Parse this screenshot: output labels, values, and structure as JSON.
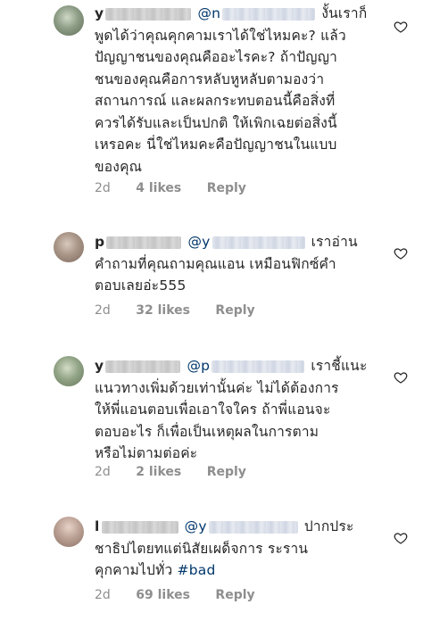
{
  "comments": [
    {
      "username": "y",
      "mention": "@n",
      "lines": [
        "งั้นเราก็",
        "พูดได้ว่าคุณคุกคามเราได้ใช่ไหมคะ? แล้ว",
        "ปัญญาชนของคุณคืออะไรคะ? ถ้าปัญญา",
        "ชนของคุณคือการหลับหูหลับตามองว่า",
        "สถานการณ์ และผลกระทบตอนนี้คือสิ่งที่",
        "ควรได้รับและเป็นปกติ ให้เพิกเฉยต่อสิ่งนี้",
        "เหรอคะ นี่ใช่ไหมคะคือปัญญาชนในแบบ",
        "ของคุณ"
      ],
      "time": "2d",
      "likes": "4 likes",
      "reply": "Reply"
    },
    {
      "username": "p",
      "mention": "@y",
      "lines": [
        "เราอ่าน",
        "คำถามที่คุณถามคุณแอน เหมือนฟิกซ์คำ",
        "ตอบเลยอ่ะ555"
      ],
      "time": "2d",
      "likes": "32 likes",
      "reply": "Reply"
    },
    {
      "username": "y",
      "mention": "@p",
      "lines": [
        "เราชี้แนะ",
        "แนวทางเพิ่มด้วยเท่านั้นค่ะ ไม่ได้ต้องการ",
        "ให้พี่แอนตอบเพื่อเอาใจใคร ถ้าพี่แอนจะ",
        "ตอบอะไร ก็เพื่อเป็นเหตุผลในการตาม",
        "หรือไม่ตามต่อค่ะ"
      ],
      "time": "2d",
      "likes": "2 likes",
      "reply": "Reply"
    },
    {
      "username": "l",
      "mention": "@y",
      "lines": [
        "ปากประ",
        "ชาธิปไตยทแต่นิสัยเผด็จการ ระราน",
        "คุกคามไปทั่ว"
      ],
      "hashtag": "#bad",
      "time": "2d",
      "likes": "69 likes",
      "reply": "Reply"
    }
  ],
  "colors": {
    "text": "#262626",
    "meta": "#8e8e8e",
    "link": "#00376b"
  },
  "icons": {
    "like": "heart-outline-icon"
  }
}
